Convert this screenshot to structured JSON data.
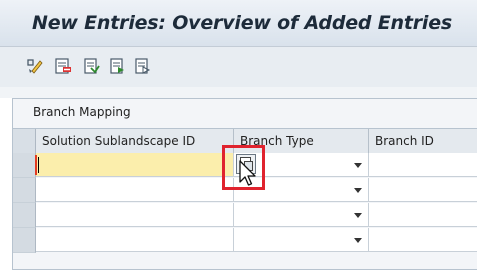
{
  "window": {
    "title": "New Entries: Overview of Added Entries"
  },
  "toolbar": {
    "buttons": [
      {
        "name": "display-change-icon"
      },
      {
        "name": "delete-icon"
      },
      {
        "name": "select-all-icon"
      },
      {
        "name": "select-block-icon"
      },
      {
        "name": "deselect-all-icon"
      }
    ]
  },
  "panel": {
    "title": "Branch Mapping",
    "columns": [
      "Solution Sublandscape ID",
      "Branch Type",
      "Branch ID"
    ],
    "rows": [
      {
        "solution_sublandscape_id": "",
        "branch_type": "",
        "branch_id": ""
      },
      {
        "solution_sublandscape_id": "",
        "branch_type": "",
        "branch_id": ""
      },
      {
        "solution_sublandscape_id": "",
        "branch_type": "",
        "branch_id": ""
      },
      {
        "solution_sublandscape_id": "",
        "branch_type": "",
        "branch_id": ""
      }
    ]
  },
  "colors": {
    "required_field": "#fbeeac",
    "highlight": "#e0232e",
    "required_marker": "#e23b22"
  }
}
